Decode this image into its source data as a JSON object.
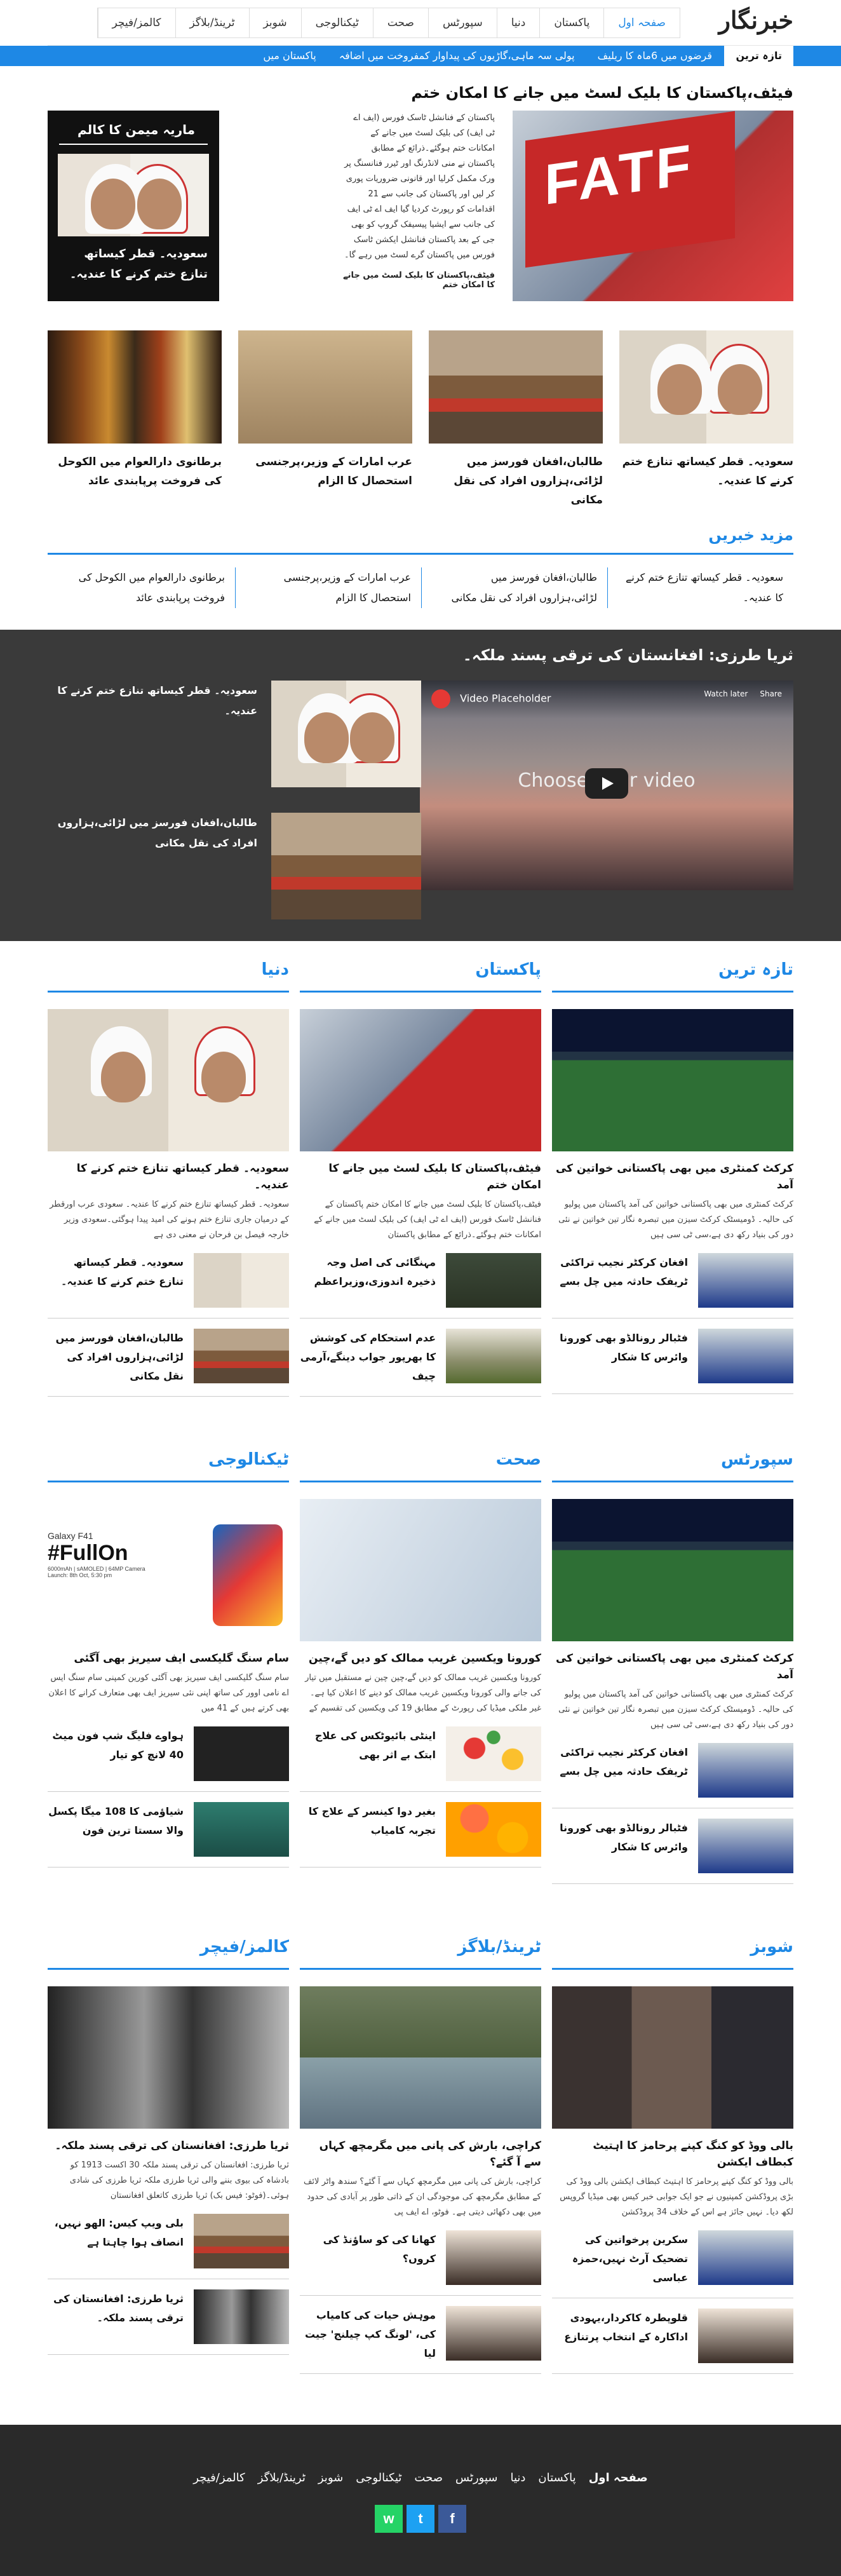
{
  "site": {
    "logo": "خبرنگار"
  },
  "nav": [
    "صفحہ اول",
    "پاکستان",
    "دنیا",
    "سپورٹس",
    "صحت",
    "ٹیکنالوجی",
    "شوبز",
    "ٹرینڈ/بلاگز",
    "کالمز/فیچر"
  ],
  "ticker": {
    "label": "تازہ ترین",
    "items": [
      "قرضوں میں 6ماہ کا ریلیف",
      "پولی سہ ماہی،گاڑیوں کی پیداوار کمفروخت میں اضافہ",
      "پاکستان میں"
    ]
  },
  "hero": {
    "title": "فیٹف،پاکستان کا بلیک لسٹ میں جانے کا امکان ختم",
    "text": "پاکستان کے فنانشل ٹاسک فورس (ایف اے ٹی ایف) کی بلیک لسٹ میں جانے کے امکانات ختم ہوگئے۔ذرائع کے مطابق پاکستان نے منی لانڈرنگ اور ٹیرر فنانسنگ پر ورک مکمل کرلیا اور قانونی ضروریات پوری کر لیں اور پاکستان کی جانب سے 21 اقدامات کو رپورٹ کردیا گیا ایف اے ٹی ایف کی جانب سے ایشیا پیسیفک گروپ کو بھی جی کے بعد پاکستان فنانشل ایکشن ٹاسک فورس میں پاکستان گرے لسٹ میں رہے گا۔",
    "more": "فیٹف،پاکستان کا بلیک لسٹ میں جانے کا امکان ختم",
    "image_label": "FATF"
  },
  "column": {
    "title": "ماریہ میمن کا کالم",
    "headline": "سعودیہ۔ قطر کیساتھ تنازع ختم کرنے کا عندیہ۔"
  },
  "top_cards": [
    "سعودیہ۔ قطر کیساتھ تنازع ختم کرنے کا عندیہ۔",
    "طالبان،افغان فورسز میں لڑائی،ہزاروں افراد کی نقل مکانی",
    "عرب امارات کے وزیر،پرجنسی استحصال کا الزام",
    "برطانوی دارالعوام میں الکوحل کی فروخت پرپابندی عائد"
  ],
  "more_news": {
    "title": "مزید خبریں",
    "items": [
      "سعودیہ۔ قطر کیساتھ تنازع ختم کرنے کا عندیہ۔",
      "طالبان،افغان فورسز میں لڑائی،ہزاروں افراد کی نقل مکانی",
      "عرب امارات کے وزیر،پرجنسی استحصال کا الزام",
      "برطانوی دارالعوام میں الکوحل کی فروخت پرپابندی عائد"
    ]
  },
  "video": {
    "title": "ثریا طرزی: افغانستان کی ترقی پسند ملکہ۔",
    "player_title": "Video Placeholder",
    "player_center": "Choose your video",
    "watch_later": "Watch later",
    "share": "Share",
    "side": [
      "سعودیہ۔ قطر کیساتھ تنازع ختم کرنے کا عندیہ۔",
      "طالبان،افغان فورسز میں لڑائی،ہزاروں افراد کی نقل مکانی"
    ]
  },
  "sections": [
    {
      "title": "تازہ ترین",
      "big_title": "کرکٹ کمنٹری میں بھی پاکستانی خواتین کی آمد",
      "big_text": "کرکٹ کمنٹری میں بھی پاکستانی خواتین کی آمد پاکستان میں پولیو کی حالیہ۔ ڈومیسٹک کرکٹ سیزن میں تبصرہ نگار تین خواتین نے نئی دور کی بنیاد رکھ دی ہے،سی ٹی سی ہیں",
      "small": [
        "افغان کرکٹر نجیب تراکئی ٹریفک حادثہ میں چل بسے",
        "فٹبالر رونالڈو بھی کورونا وائرس کا شکار"
      ]
    },
    {
      "title": "پاکستان",
      "big_title": "فیٹف،پاکستان کا بلیک لسٹ میں جانے کا امکان ختم",
      "big_text": "فیٹف،پاکستان کا بلیک لسٹ میں جانے کا امکان ختم پاکستان کے فنانشل ٹاسک فورس (ایف اے ٹی ایف) کی بلیک لسٹ میں جانے کے امکانات ختم ہوگئے۔ذرائع کے مطابق پاکستان",
      "small": [
        "مہنگائی کی اصل وجہ ذخیرہ اندوزی،وزیراعظم",
        "عدم استحکام کی کوشش کا بھرپور جواب دینگے،آرمی چیف"
      ]
    },
    {
      "title": "دنیا",
      "big_title": "سعودیہ۔ قطر کیساتھ تنازع ختم کرنے کا عندیہ۔",
      "big_text": "سعودیہ۔ قطر کیساتھ تنازع ختم کرنے کا عندیہ۔ سعودی عرب اورقطر کے درمیان جاری تنازع ختم ہونے کی امید پیدا ہوگئی۔سعودی وزیر خارجہ فیصل بن فرحان نے معنی دی ہے",
      "small": [
        "سعودیہ۔ قطر کیساتھ تنازع ختم کرنے کا عندیہ۔",
        "طالبان،افغان فورسز میں لڑائی،ہزاروں افراد کی نقل مکانی"
      ]
    },
    {
      "title": "سپورٹس",
      "big_title": "کرکٹ کمنٹری میں بھی پاکستانی خواتین کی آمد",
      "big_text": "کرکٹ کمنٹری میں بھی پاکستانی خواتین کی آمد پاکستان میں پولیو کی حالیہ۔ ڈومیسٹک کرکٹ سیزن میں تبصرہ نگار تین خواتین نے نئی دور کی بنیاد رکھ دی ہے،سی ٹی سی ہیں",
      "small": [
        "افغان کرکٹر نجیب تراکئی ٹریفک حادثہ میں چل بسے",
        "فٹبالر رونالڈو بھی کورونا وائرس کا شکار"
      ]
    },
    {
      "title": "صحت",
      "big_title": "کورونا ویکسین غریب ممالک کو دیں گے،چین",
      "big_text": "کورونا ویکسین غریب ممالک کو دیں گے،چین چین نے مستقبل میں تیار کی جانے والی کورونا ویکسین غریب ممالک کو دینے کا اعلان کیا ہے۔ غیر ملکی میڈیا کی رپورٹ کے مطابق 19 کی ویکسین کی تقسیم کے حوالے سے ایک معاہدے پر دستخط کر دیئے",
      "small": [
        "اینٹی بائیوٹکس کی علاج ابتک بے اثر بھی",
        "بغیر دوا کینسر کے علاج کا تجربہ کامیاب"
      ]
    },
    {
      "title": "ٹیکنالوجی",
      "big_title": "سام سنگ گلیکسی ایف سیریز بھی آگئی",
      "big_text": "سام سنگ گلیکسی ایف سیریز بھی آگئی کورین کمپنی سام سنگ ایس اے نامی اوور کی ساتھ اپنی نئی سیریز ایف بھی متعارف کرانے کا اعلان بھی کرتے ہیں کے 41 میں",
      "small": [
        "ہواوے فلیگ شپ فون میٹ 40 لانچ کو تیار",
        "شیاؤمی کا 108 میگا پکسل والا سستا ترین فون"
      ],
      "phone_label": "Galaxy F41",
      "phone_big": "#FullOn",
      "phone_sub": "6000mAh | sAMOLED | 64MP Camera",
      "phone_launch": "Launch: 8th Oct, 5:30 pm"
    },
    {
      "title": "شوبز",
      "big_title": "بالی ووڈ کو کنگ کپنے پرحامز کا اہتیٹ کبطاف ایکشن",
      "big_text": "بالی ووڈ کو کنگ کپنے پرحامز کا اہتیٹ کبطاف ایکشن بالی ووڈ کی بڑی پروڈکشن کمپنیوں نے جو ایک جوابی خبر کیس بھی میڈیا گروپس لکھ دیا۔ نہیں جائز ہے اس کے خلاف 34 پروڈکشن",
      "small": [
        "سکرین پرخواتین کی تضحیک آرٹ نہیں،حمزہ عباسی",
        "قلوپطرہ کاکردار،یہودی اداکارہ کے انتخاب پرتنازع"
      ]
    },
    {
      "title": "ٹرینڈ/بلاگز",
      "big_title": "کراچی، بارش کی پانی میں مگرمچھ کہاں سے آ گئے؟",
      "big_text": "کراچی، بارش کی پانی میں مگرمچھ کہاں سے آ گئے؟ سندھ واٹر لائف کے مطابق مگرمچھ کی موجودگی ان کے ذاتی طور پر آبادی کی حدود میں بھی دکھائی دیتی ہے۔ فوٹو، اے ایف پی",
      "small": [
        "کھانا کی کو ساؤنڈ کی کروں؟",
        "موہش حیات کی کامیاب کی، 'لونگ کپ چیلنج' جیت لیا"
      ]
    },
    {
      "title": "کالمز/فیچر",
      "big_title": "ثریا طرزی: افغانستان کی ترقی پسند ملکہ۔",
      "big_text": "ثریا طرزی: افغانستان کی ترقی پسند ملکہ 30 اکست 1913 کو بادشاہ کی بیوی بننے والی ثریا طرزی ملکہ ثریا طرزی کی شادی ہوئی۔(فوٹو: فیس بک) ثریا طرزی کاتعلق افغانستان",
      "small": [
        "بلی ویپ کیس: الھو نہیں، انصاف ہوا چاہتا ہے",
        "ثریا طرزی: افغانستان کی ترقی پسند ملکہ۔"
      ]
    }
  ],
  "footer": {
    "nav": [
      "صفحہ اول",
      "پاکستان",
      "دنیا",
      "سپورٹس",
      "صحت",
      "ٹیکنالوجی",
      "شوبز",
      "ٹرینڈ/بلاگز",
      "کالمز/فیچر"
    ],
    "social": [
      {
        "name": "facebook-icon",
        "glyph": "f",
        "color": "#3b5998"
      },
      {
        "name": "twitter-icon",
        "glyph": "t",
        "color": "#1da1f2"
      },
      {
        "name": "whatsapp-icon",
        "glyph": "w",
        "color": "#25d366"
      }
    ]
  }
}
